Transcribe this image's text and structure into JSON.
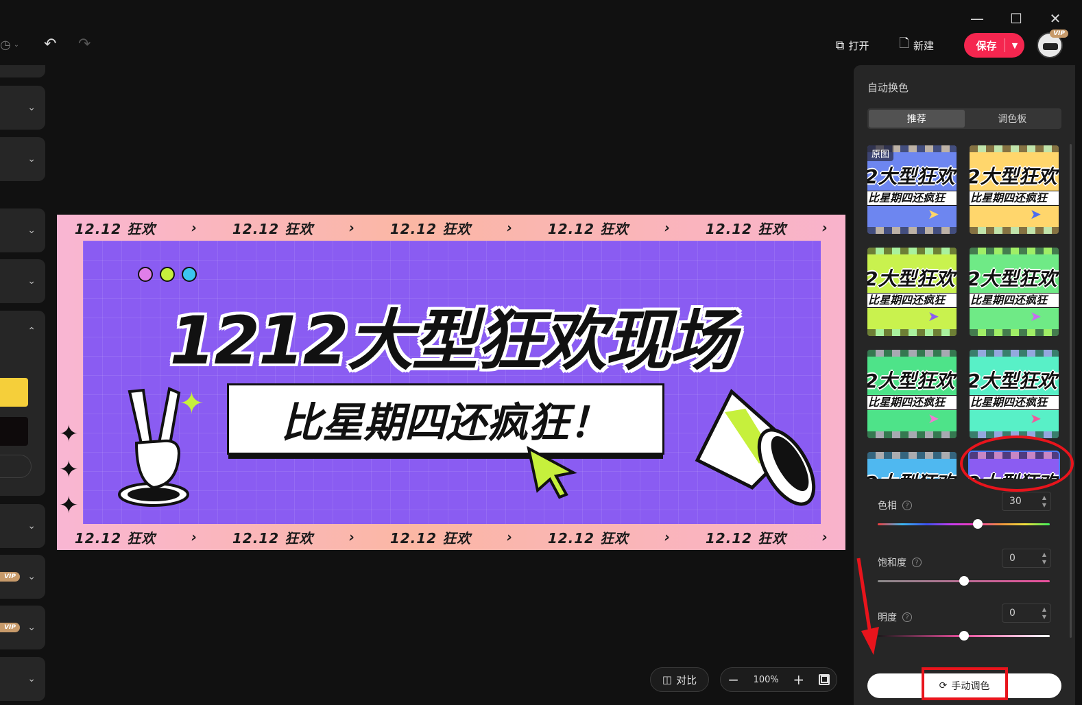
{
  "window": {
    "minimize_icon": "minimize-icon",
    "maximize_icon": "maximize-icon",
    "close_icon": "close-icon"
  },
  "toolbar": {
    "open_label": "打开",
    "new_label": "新建",
    "save_label": "保存",
    "vip_badge": "VIP"
  },
  "left_panels": {
    "vip_label": "VIP"
  },
  "banner": {
    "strip_text": "12.12 狂欢",
    "headline": "1212大型狂欢现场",
    "subtitle": "比星期四还疯狂！"
  },
  "panel": {
    "title": "自动换色",
    "tabs": [
      {
        "label": "推荐",
        "active": true
      },
      {
        "label": "调色板",
        "active": false
      }
    ],
    "thumbnails": [
      {
        "tag": "原图",
        "bg": "#6d86f0",
        "accent": "#ffd76a"
      },
      {
        "tag": "",
        "bg": "#ffd66c",
        "accent": "#8ff0e0"
      },
      {
        "tag": "",
        "bg": "#c9f24e",
        "accent": "#8ff0e0"
      },
      {
        "tag": "",
        "bg": "#6fea86",
        "accent": "#c8f04e"
      },
      {
        "tag": "",
        "bg": "#4ee389",
        "accent": "#f07ad2"
      },
      {
        "tag": "",
        "bg": "#58f0c7",
        "accent": "#c66df0"
      },
      {
        "tag": "",
        "bg": "#4fb8f0",
        "accent": "#f7a27a"
      },
      {
        "tag": "",
        "bg": "#8b5cf2",
        "accent": "#f9a9a0"
      }
    ],
    "hue": {
      "label": "色相",
      "value": "30",
      "level": 0.58
    },
    "saturation": {
      "label": "饱和度",
      "value": "0",
      "level": 0.5
    },
    "brightness": {
      "label": "明度",
      "value": "0",
      "level": 0.5
    },
    "manual_label": "手动调色"
  },
  "canvas_controls": {
    "compare_label": "对比",
    "zoom_value": "100%"
  },
  "colors": {
    "accent": "#f5264f",
    "annotation": "#e8141c",
    "banner_purple": "#8a5cf2"
  }
}
